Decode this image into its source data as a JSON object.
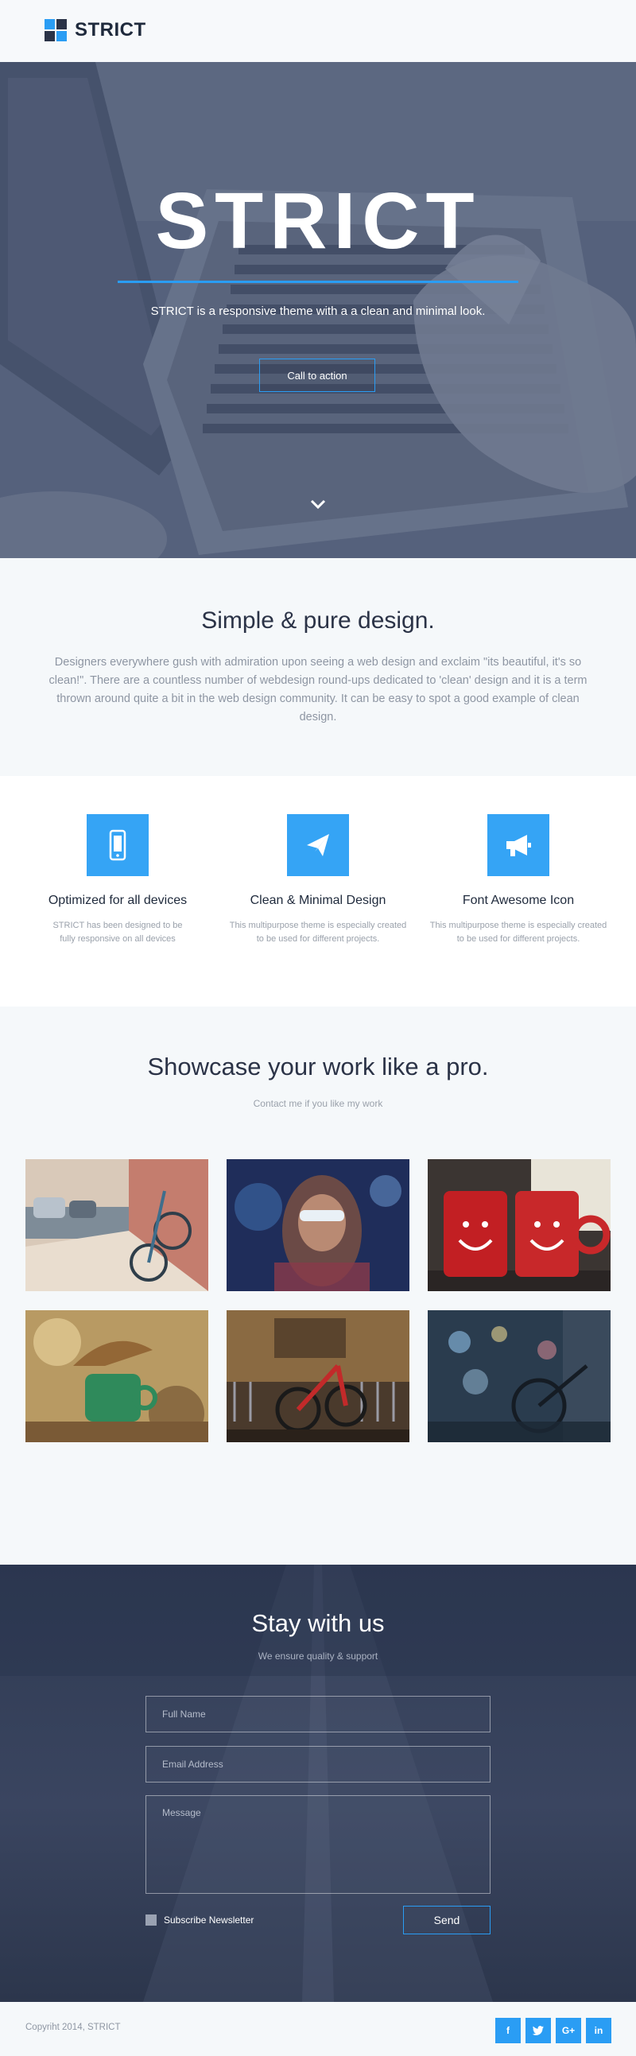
{
  "header": {
    "logo_text": "STRICT"
  },
  "hero": {
    "title": "STRICT",
    "subtitle": "STRICT is a responsive theme with a a clean and minimal look.",
    "cta_label": "Call to action"
  },
  "intro": {
    "title": "Simple & pure design.",
    "body": "Designers everywhere gush with admiration upon seeing a web design and exclaim \"its beautiful, it's so clean!\". There are a countless number of webdesign round-ups dedicated to 'clean' design and it is a term thrown around quite a bit in the web design community. It can be easy to spot a good example of clean design."
  },
  "features": [
    {
      "icon": "mobile-icon",
      "title": "Optimized for all devices",
      "text": "STRICT has been designed to be fully responsive on all devices"
    },
    {
      "icon": "paper-plane-icon",
      "title": "Clean & Minimal Design",
      "text": "This multipurpose theme is especially created\nto be used for different projects."
    },
    {
      "icon": "bullhorn-icon",
      "title": "Font Awesome Icon",
      "text": "This multipurpose theme is especially created\nto be used for different projects."
    }
  ],
  "showcase": {
    "title": "Showcase your work like a pro.",
    "subtitle": "Contact me if you like my work",
    "items": [
      "bicycle-street-photo",
      "woman-sunglasses-photo",
      "red-mugs-photo",
      "green-cup-splash-photo",
      "red-bicycle-photo",
      "bicycle-bokeh-photo"
    ]
  },
  "contact": {
    "title": "Stay with us",
    "subtitle": "We ensure quality & support",
    "name_placeholder": "Full Name",
    "email_placeholder": "Email Address",
    "message_placeholder": "Message",
    "subscribe_label": "Subscribe Newsletter",
    "send_label": "Send"
  },
  "footer": {
    "copyright": "Copyriht 2014, STRICT",
    "social": [
      "f",
      "t",
      "G+",
      "in"
    ]
  },
  "colors": {
    "accent": "#2a9df4",
    "dark": "#2b3347",
    "light_bg": "#f5f8fa"
  }
}
